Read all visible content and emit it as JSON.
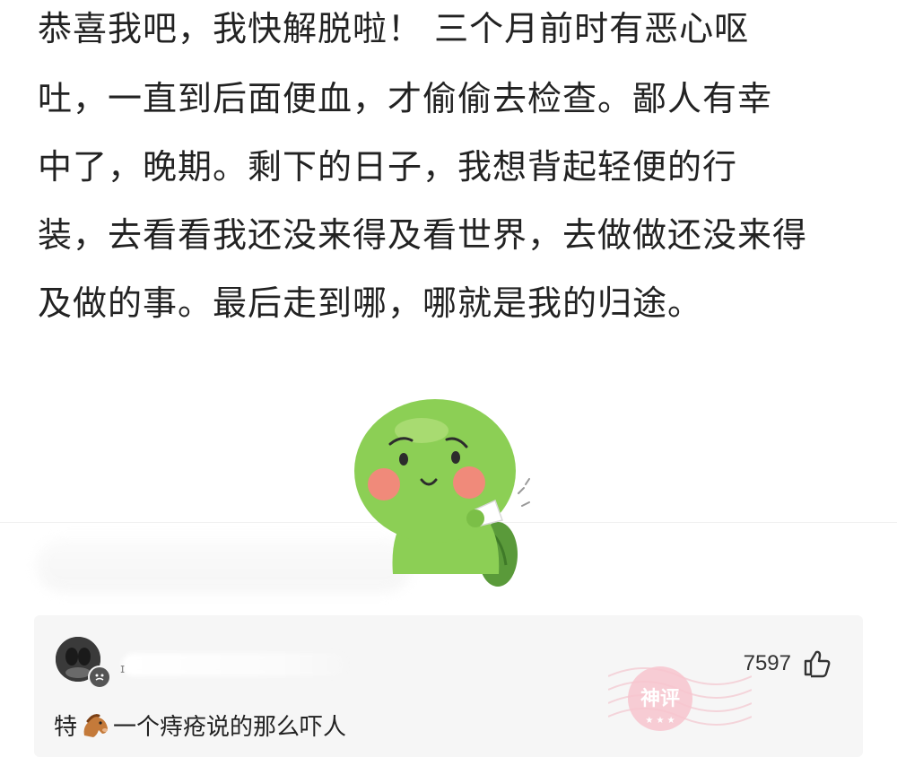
{
  "post": {
    "lines": [
      "恭喜我吧，我快解脱啦！ 三个月前时有恶心呕",
      "吐，一直到后面便血，才偷偷去检查。鄙人有幸",
      "中了，晚期。剩下的日子，我想背起轻便的行",
      "装，去看看我还没来得及看世界，去做做还没来得",
      "及做的事。最后走到哪，哪就是我的归途。"
    ],
    "sticker": "turtle-wiping-sweat-sticker"
  },
  "comment": {
    "username_initial": "ɪ",
    "likes": "7597",
    "stamp_text": "神评",
    "text_before": "特",
    "icon": "horse-emoji-icon",
    "text_after": "一个痔疮说的那么吓人"
  },
  "colors": {
    "text": "#222222",
    "card_bg": "#f6f6f6",
    "stamp": "#f3b9c4",
    "turtle": "#8ccf55"
  }
}
